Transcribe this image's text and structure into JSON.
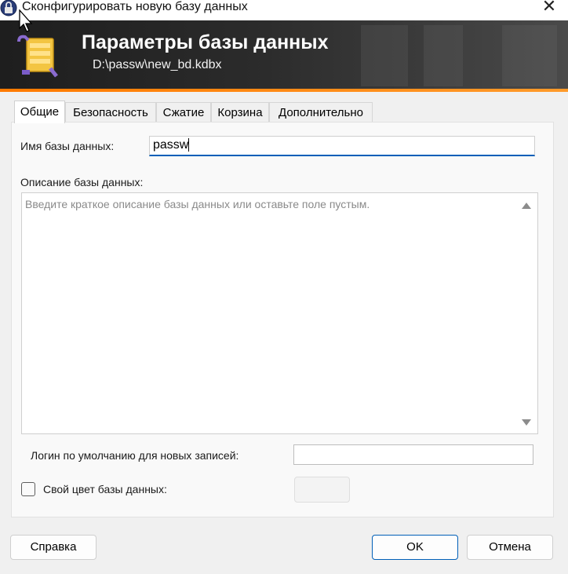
{
  "window": {
    "title": "Сконфигурировать новую базу данных",
    "close_icon": "✕"
  },
  "banner": {
    "title": "Параметры базы данных",
    "path": "D:\\passw\\new_bd.kdbx"
  },
  "tabs": [
    {
      "label": "Общие",
      "active": true
    },
    {
      "label": "Безопасность",
      "active": false
    },
    {
      "label": "Сжатие",
      "active": false
    },
    {
      "label": "Корзина",
      "active": false
    },
    {
      "label": "Дополнительно",
      "active": false
    }
  ],
  "general": {
    "db_name_label": "Имя базы данных:",
    "db_name_value": "passw",
    "description_label": "Описание базы данных:",
    "description_placeholder": "Введите краткое описание базы данных или оставьте поле пустым.",
    "default_login_label": "Логин по умолчанию для новых записей:",
    "default_login_value": "",
    "custom_color_label": "Свой цвет базы данных:",
    "custom_color_checked": false
  },
  "buttons": {
    "help": "Справка",
    "ok": "OK",
    "cancel": "Отмена"
  },
  "colors": {
    "banner_accent": "#ff8a00",
    "focus_blue": "#005fb8"
  }
}
